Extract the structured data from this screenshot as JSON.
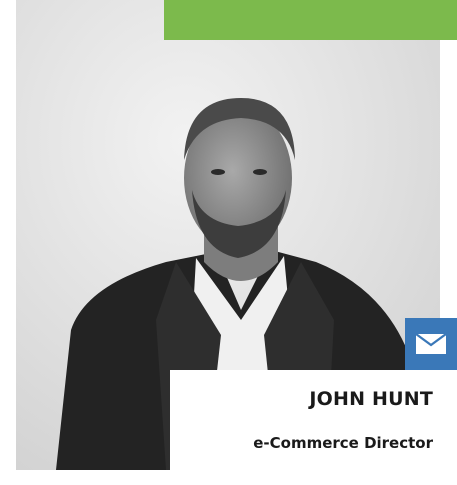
{
  "colors": {
    "accent": "#7cba4c",
    "email_button": "#3a78b8",
    "text": "#1a1a1a"
  },
  "profile": {
    "photo_icon": "person-portrait-icon",
    "name": "JOHN HUNT",
    "title": "e-Commerce Director",
    "email_icon": "envelope-icon"
  }
}
